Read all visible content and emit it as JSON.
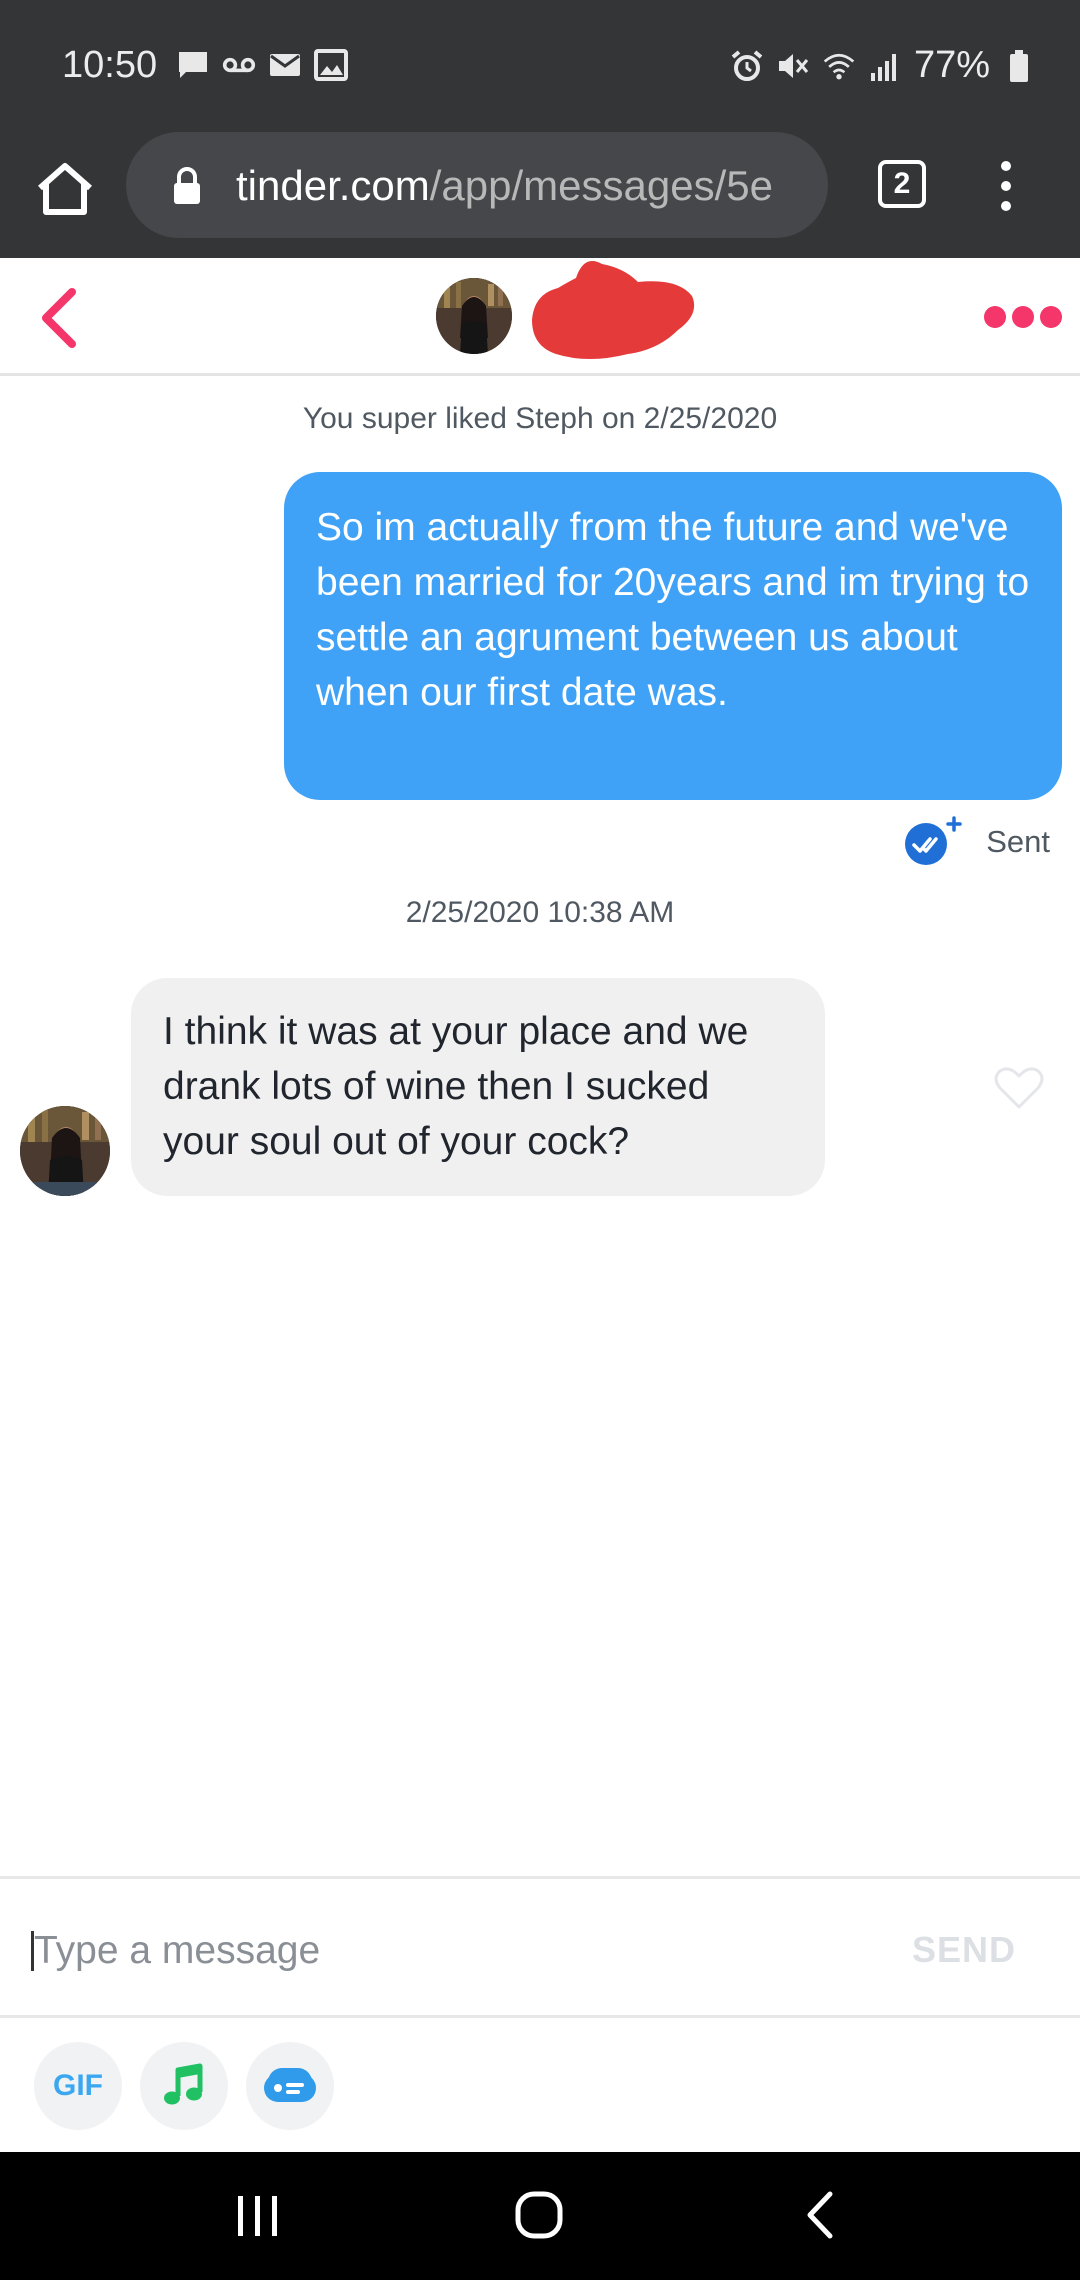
{
  "status_bar": {
    "time": "10:50",
    "battery": "77%",
    "left_icons": [
      "chat-bubble-icon",
      "voicemail-icon",
      "mail-icon",
      "image-icon"
    ],
    "right_icons": [
      "alarm-icon",
      "mute-icon",
      "wifi-icon",
      "signal-icon",
      "battery-icon"
    ]
  },
  "browser": {
    "url_host": "tinder.com",
    "url_path": "/app/messages/5e",
    "tab_count": "2"
  },
  "chat_header": {
    "name_redacted": true,
    "redaction_color": "#e53a3a"
  },
  "messages": {
    "superlike_note": "You super liked Steph on 2/25/2020",
    "outgoing_text": "So im actually from the future and we've been married for 20years and im trying to settle an agrument between us about when our first date was.",
    "sent_label": "Sent",
    "timestamp": "2/25/2020 10:38 AM",
    "incoming_text": "I think it was at your place and we drank lots of wine then I sucked your soul out of your cock?"
  },
  "composer": {
    "placeholder": "Type a message",
    "send_label": "SEND"
  },
  "tools": {
    "gif_label": "GIF"
  },
  "colors": {
    "accent": "#f5366a",
    "outgoing_bubble": "#40a2f6",
    "incoming_bubble": "#f0f0f0"
  }
}
